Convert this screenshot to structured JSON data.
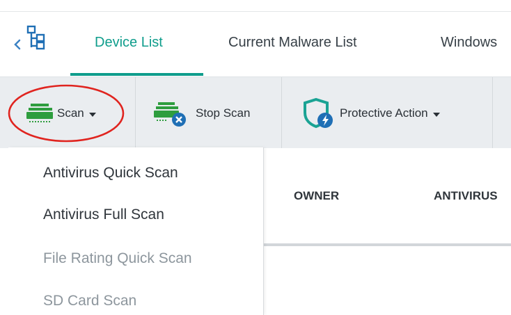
{
  "tabs": [
    {
      "label": "Device List",
      "active": true
    },
    {
      "label": "Current Malware List",
      "active": false
    },
    {
      "label": "Windows",
      "active": false
    }
  ],
  "toolbar": {
    "scan_label": "Scan",
    "stop_scan_label": "Stop Scan",
    "protective_action_label": "Protective Action"
  },
  "scan_menu": {
    "items": [
      {
        "label": "Antivirus Quick Scan",
        "enabled": true
      },
      {
        "label": "Antivirus Full Scan",
        "enabled": true
      },
      {
        "label": "File Rating Quick Scan",
        "enabled": false
      },
      {
        "label": "SD Card Scan",
        "enabled": false
      }
    ]
  },
  "table": {
    "columns": [
      "OWNER",
      "ANTIVIRUS"
    ]
  },
  "colors": {
    "accent": "#0f9d8c",
    "highlight_circle": "#e0241f",
    "toolbar_bg": "#eaedf0"
  },
  "icons": [
    "back-chevron-icon",
    "device-tree-icon",
    "scanner-icon",
    "stop-scan-icon",
    "shield-bolt-icon",
    "caret-down-icon"
  ]
}
